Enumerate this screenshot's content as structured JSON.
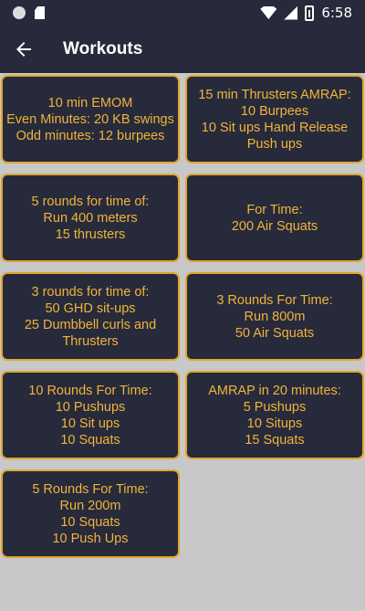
{
  "status_bar": {
    "time": "6:58"
  },
  "app_bar": {
    "title": "Workouts"
  },
  "workouts": [
    "10 min EMOM\nEven Minutes: 20 KB swings\nOdd minutes: 12 burpees",
    "15 min Thrusters AMRAP:\n10 Burpees\n10 Sit ups  Hand Release\nPush ups",
    "5 rounds for time of:\nRun 400 meters\n15 thrusters",
    "For Time:\n200 Air Squats",
    "3 rounds for time of:\n50 GHD sit-ups\n25 Dumbbell curls and\nThrusters",
    "3 Rounds For Time:\nRun 800m\n50 Air Squats",
    "10 Rounds For Time:\n10 Pushups\n10 Sit ups\n10 Squats",
    "AMRAP in 20 minutes:\n5 Pushups\n10 Situps\n15 Squats",
    "5 Rounds For Time:\nRun 200m\n10 Squats\n10 Push Ups"
  ]
}
